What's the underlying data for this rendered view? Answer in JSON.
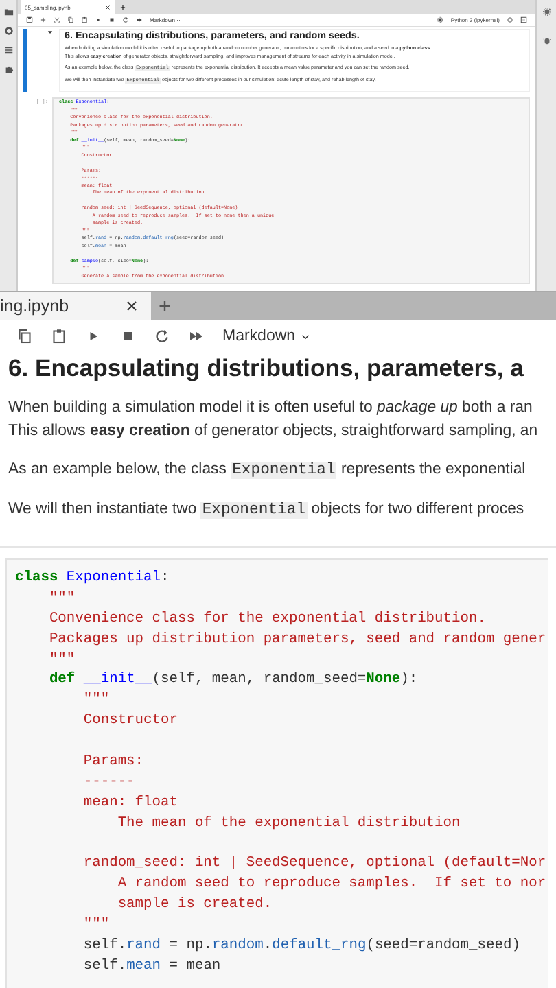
{
  "overview": {
    "tab": {
      "label": "05_sampling.ipynb"
    },
    "toolbar": {
      "cell_type": "Markdown",
      "kernel": "Python 3 (ipykernel)"
    },
    "markdown_cell": {
      "heading": "6. Encapsulating distributions, parameters, and random seeds.",
      "paragraphs": [
        {
          "lines": [
            [
              {
                "kind": "text",
                "text": "When building a simulation model it is often useful to package up both a random number generator, parameters for a specific distribution, and a seed in a **python class**."
              }
            ],
            [
              {
                "kind": "text",
                "text": "This allows **easy creation** of generator objects, straightforward sampling, and improves management of streams for each activity in a simulation model."
              }
            ]
          ]
        },
        {
          "lines": [
            [
              {
                "kind": "text",
                "text": "As an example below, the class "
              },
              {
                "kind": "code",
                "text": "Exponential"
              },
              {
                "kind": "text",
                "text": " represents the exponential distribution. It accepts a mean value parameter and you can set the random seed."
              }
            ]
          ]
        },
        {
          "lines": [
            [
              {
                "kind": "text",
                "text": "We will then instantiate two "
              },
              {
                "kind": "code",
                "text": "Exponential"
              },
              {
                "kind": "text",
                "text": " objects for two different processes in our simulation: acute length of stay, and rehab length of stay."
              }
            ]
          ]
        }
      ]
    },
    "code_cell": {
      "prompt": "[ ]:",
      "lines": [
        {
          "kind": "code",
          "tokens": [
            {
              "kw": "class"
            },
            {
              "cls": " Exponential"
            },
            {
              "plain": ":"
            }
          ]
        },
        {
          "kind": "code",
          "tokens": [
            {
              "doc": "    \"\"\""
            }
          ]
        },
        {
          "kind": "code",
          "tokens": [
            {
              "doc": "    Convenience class for the exponential distribution."
            }
          ]
        },
        {
          "kind": "code",
          "tokens": [
            {
              "doc": "    Packages up distribution parameters, seed and random generator."
            }
          ]
        },
        {
          "kind": "code",
          "tokens": [
            {
              "doc": "    \"\"\""
            }
          ]
        },
        {
          "kind": "code",
          "tokens": [
            {
              "kw": "    def"
            },
            {
              "fn": " __init__"
            },
            {
              "plain": "(self, mean, random_seed="
            },
            {
              "kw": "None"
            },
            {
              "plain": "):"
            }
          ]
        },
        {
          "kind": "code",
          "tokens": [
            {
              "doc": "        \"\"\""
            }
          ]
        },
        {
          "kind": "code",
          "tokens": [
            {
              "doc": "        Constructor"
            }
          ]
        },
        {
          "kind": "blank"
        },
        {
          "kind": "code",
          "tokens": [
            {
              "doc": "        Params:"
            }
          ]
        },
        {
          "kind": "code",
          "tokens": [
            {
              "doc": "        ------"
            }
          ]
        },
        {
          "kind": "code",
          "tokens": [
            {
              "doc": "        mean: float"
            }
          ]
        },
        {
          "kind": "code",
          "tokens": [
            {
              "doc": "            The mean of the exponential distribution"
            }
          ]
        },
        {
          "kind": "blank"
        },
        {
          "kind": "code",
          "tokens": [
            {
              "doc": "        random_seed: int | SeedSequence, optional (default=None)"
            }
          ]
        },
        {
          "kind": "code",
          "tokens": [
            {
              "doc": "            A random seed to reproduce samples.  If set to none then a unique"
            }
          ]
        },
        {
          "kind": "code",
          "tokens": [
            {
              "doc": "            sample is created."
            }
          ]
        },
        {
          "kind": "code",
          "tokens": [
            {
              "doc": "        \"\"\""
            }
          ]
        },
        {
          "kind": "code",
          "tokens": [
            {
              "plain": "        self."
            },
            {
              "attr": "rand"
            },
            {
              "plain": " = np."
            },
            {
              "attr": "random"
            },
            {
              "plain": "."
            },
            {
              "attr": "default_rng"
            },
            {
              "plain": "(seed=random_seed)"
            }
          ]
        },
        {
          "kind": "code",
          "tokens": [
            {
              "plain": "        self."
            },
            {
              "attr": "mean"
            },
            {
              "plain": " = mean"
            }
          ]
        },
        {
          "kind": "blank"
        },
        {
          "kind": "code",
          "tokens": [
            {
              "kw": "    def"
            },
            {
              "fn": " sample"
            },
            {
              "plain": "(self, size="
            },
            {
              "kw": "None"
            },
            {
              "plain": "):"
            }
          ]
        },
        {
          "kind": "code",
          "tokens": [
            {
              "doc": "        \"\"\""
            }
          ]
        },
        {
          "kind": "code",
          "tokens": [
            {
              "doc": "        Generate a sample from the exponential distribution"
            }
          ]
        }
      ]
    }
  },
  "zoomed": {
    "tab": {
      "label": "ing.ipynb"
    },
    "toolbar": {
      "cell_type": "Markdown"
    },
    "markdown_cell": {
      "heading": "6. Encapsulating distributions, parameters, a",
      "paragraphs": [
        {
          "lines": [
            [
              {
                "kind": "text",
                "text": "When building a simulation model it is often useful to *package up* both a ran"
              }
            ],
            [
              {
                "kind": "text",
                "text": "This allows **easy creation** of generator objects, straightforward sampling, an"
              }
            ]
          ]
        },
        {
          "lines": [
            [
              {
                "kind": "text",
                "text": "As an example below, the class "
              },
              {
                "kind": "code",
                "text": "Exponential"
              },
              {
                "kind": "text",
                "text": " represents the exponential"
              }
            ]
          ]
        },
        {
          "lines": [
            [
              {
                "kind": "text",
                "text": "We will then instantiate two "
              },
              {
                "kind": "code",
                "text": "Exponential"
              },
              {
                "kind": "text",
                "text": " objects for two different proces"
              }
            ]
          ]
        }
      ]
    },
    "code_cell": {
      "lines": [
        {
          "kind": "code",
          "tokens": [
            {
              "kw": "class"
            },
            {
              "cls": " Exponential"
            },
            {
              "plain": ":"
            }
          ]
        },
        {
          "kind": "code",
          "tokens": [
            {
              "doc": "    \"\"\""
            }
          ]
        },
        {
          "kind": "code",
          "tokens": [
            {
              "doc": "    Convenience class for the exponential distribution."
            }
          ]
        },
        {
          "kind": "code",
          "tokens": [
            {
              "doc": "    Packages up distribution parameters, seed and random gener"
            }
          ]
        },
        {
          "kind": "code",
          "tokens": [
            {
              "doc": "    \"\"\""
            }
          ]
        },
        {
          "kind": "code",
          "tokens": [
            {
              "kw": "    def"
            },
            {
              "fn": " __init__"
            },
            {
              "plain": "(self, mean, random_seed="
            },
            {
              "kw": "None"
            },
            {
              "plain": "):"
            }
          ]
        },
        {
          "kind": "code",
          "tokens": [
            {
              "doc": "        \"\"\""
            }
          ]
        },
        {
          "kind": "code",
          "tokens": [
            {
              "doc": "        Constructor"
            }
          ]
        },
        {
          "kind": "blank"
        },
        {
          "kind": "code",
          "tokens": [
            {
              "doc": "        Params:"
            }
          ]
        },
        {
          "kind": "code",
          "tokens": [
            {
              "doc": "        ------"
            }
          ]
        },
        {
          "kind": "code",
          "tokens": [
            {
              "doc": "        mean: float"
            }
          ]
        },
        {
          "kind": "code",
          "tokens": [
            {
              "doc": "            The mean of the exponential distribution"
            }
          ]
        },
        {
          "kind": "blank"
        },
        {
          "kind": "code",
          "tokens": [
            {
              "doc": "        random_seed: int | SeedSequence, optional (default=Nor"
            }
          ]
        },
        {
          "kind": "code",
          "tokens": [
            {
              "doc": "            A random seed to reproduce samples.  If set to nor"
            }
          ]
        },
        {
          "kind": "code",
          "tokens": [
            {
              "doc": "            sample is created."
            }
          ]
        },
        {
          "kind": "code",
          "tokens": [
            {
              "doc": "        \"\"\""
            }
          ]
        },
        {
          "kind": "code",
          "tokens": [
            {
              "plain": "        self."
            },
            {
              "attr": "rand"
            },
            {
              "plain": " = np."
            },
            {
              "attr": "random"
            },
            {
              "plain": "."
            },
            {
              "attr": "default_rng"
            },
            {
              "plain": "(seed=random_seed)"
            }
          ]
        },
        {
          "kind": "code",
          "tokens": [
            {
              "plain": "        self."
            },
            {
              "attr": "mean"
            },
            {
              "plain": " = mean"
            }
          ]
        }
      ]
    }
  }
}
